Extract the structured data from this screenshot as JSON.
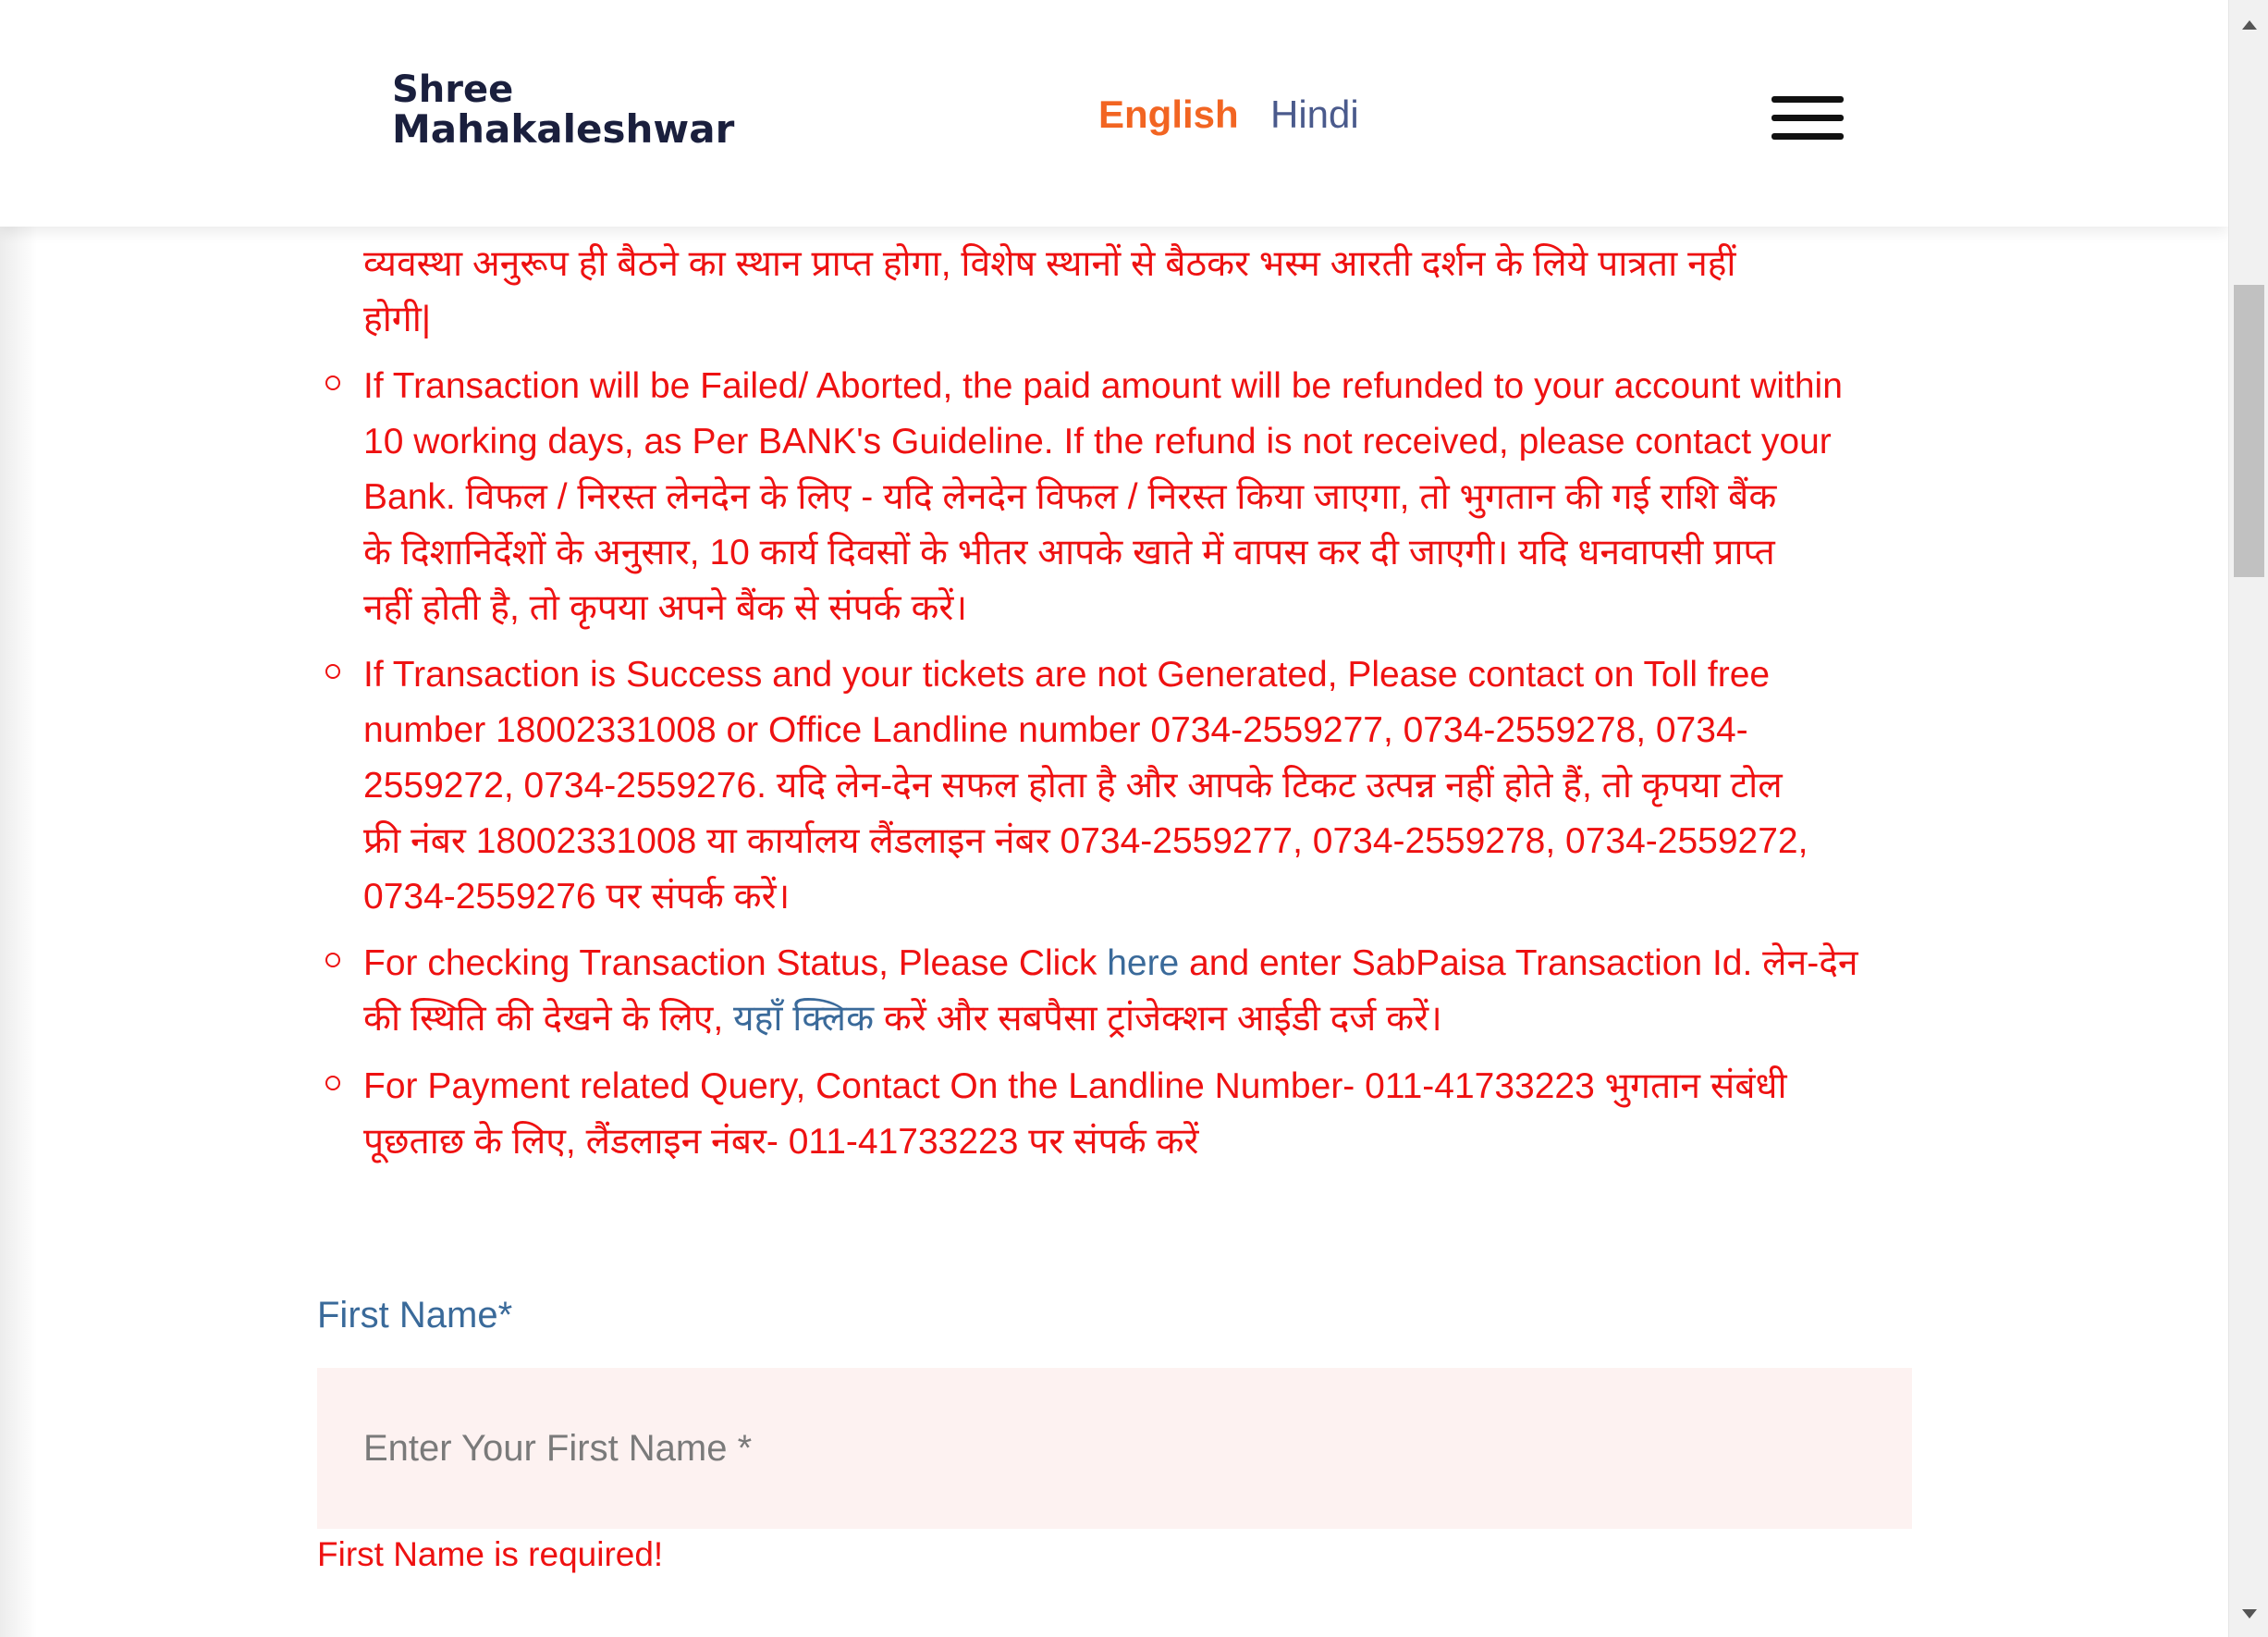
{
  "header": {
    "logo_line1": "Shree",
    "logo_line2": "Mahakaleshwar",
    "lang_english": "English",
    "lang_hindi": "Hindi",
    "menu_icon": "hamburger-menu-icon"
  },
  "content": {
    "cut_line": "…",
    "intro_line1": "व्यवस्था अनुरूप ही बैठने का स्थान प्राप्त होगा, विशेष स्थानों से बैठकर भस्म आरती दर्शन के लिये पात्रता नहीं",
    "intro_line2": "होगी|",
    "items": [
      {
        "lines": [
          "If Transaction will be Failed/ Aborted, the paid amount will be refunded to your account within",
          "10 working days, as Per BANK's Guideline. If the refund is not received, please contact your",
          "Bank. विफल / निरस्त लेनदेन के लिए - यदि लेनदेन विफल / निरस्त किया जाएगा, तो भुगतान की गई राशि बैंक",
          "के दिशानिर्देशों के अनुसार, 10 कार्य दिवसों के भीतर आपके खाते में वापस कर दी जाएगी। यदि धनवापसी प्राप्त",
          "नहीं होती है, तो कृपया अपने बैंक से संपर्क करें।"
        ]
      },
      {
        "lines": [
          "If Transaction is Success and your tickets are not Generated, Please contact on Toll free",
          "number 18002331008 or Office Landline number 0734-2559277, 0734-2559278, 0734-",
          "2559272, 0734-2559276. यदि लेन-देन सफल होता है और आपके टिकट उत्पन्न नहीं होते हैं, तो कृपया टोल",
          "फ्री नंबर 18002331008 या कार्यालय लैंडलाइन नंबर 0734-2559277, 0734-2559278, 0734-2559272,",
          "0734-2559276 पर संपर्क करें।"
        ]
      },
      {
        "line1_pre": "For checking Transaction Status, Please Click ",
        "line1_link": "here",
        "line1_post": " and enter SabPaisa Transaction Id. लेन-देन",
        "line2_pre": "की स्थिति की देखने के लिए, ",
        "line2_link": "यहाँ क्लिक",
        "line2_post": " करें और सबपैसा ट्रांजेक्शन आईडी दर्ज करें।"
      },
      {
        "lines": [
          "For Payment related Query, Contact On the Landline Number- 011-41733223 भुगतान संबंधी",
          "पूछताछ के लिए, लैंडलाइन नंबर- 011-41733223 पर संपर्क करें"
        ]
      }
    ]
  },
  "form": {
    "first_name_label": "First Name*",
    "first_name_value": "",
    "first_name_placeholder": "Enter Your First Name *",
    "first_name_error": "First Name is required!"
  },
  "colors": {
    "accent_orange": "#f26522",
    "text_red": "#ee1111",
    "link_blue": "#3a6a9a",
    "input_bg": "#fdf2f1"
  }
}
